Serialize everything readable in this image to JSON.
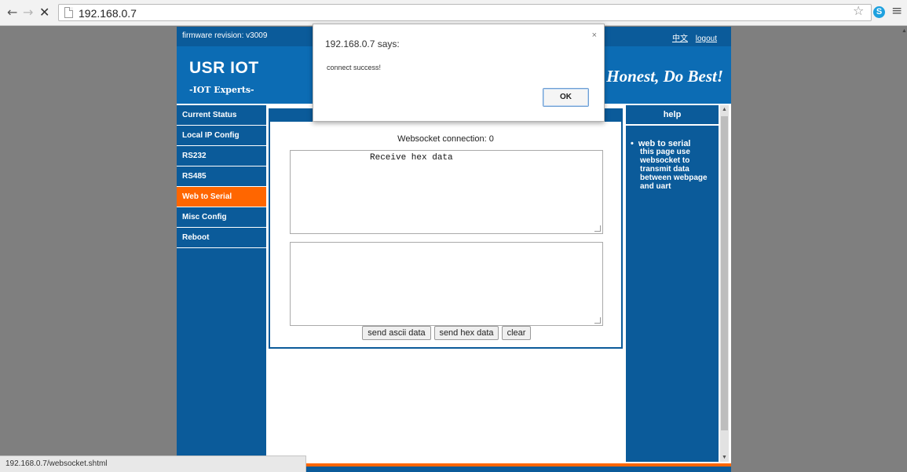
{
  "browser": {
    "url": "192.168.0.7",
    "icons": {
      "back": "arrow-left-icon",
      "forward": "arrow-right-icon",
      "stop": "close-icon",
      "bookmark": "star-icon",
      "extension": "skype-icon",
      "menu": "hamburger-menu-icon"
    },
    "back_glyph": "←",
    "forward_glyph": "→",
    "stop_glyph": "✕",
    "star_glyph": "☆",
    "skype_glyph": "S",
    "menu_glyph": "≡",
    "status_url": "192.168.0.7/websocket.shtml"
  },
  "page": {
    "firmware_label": "firmware revision: v3009",
    "language_link": "中文",
    "logout_link": "logout",
    "brand": "USR IOT",
    "brand_sub": "-IOT Experts-",
    "slogan": "Honest, Do Best!",
    "sidebar": {
      "items": [
        {
          "label": "Current Status",
          "active": false
        },
        {
          "label": "Local IP Config",
          "active": false
        },
        {
          "label": "RS232",
          "active": false
        },
        {
          "label": "RS485",
          "active": false
        },
        {
          "label": "Web to Serial",
          "active": true
        },
        {
          "label": "Misc Config",
          "active": false
        },
        {
          "label": "Reboot",
          "active": false
        }
      ]
    },
    "main": {
      "ws_status": "Websocket connection: 0",
      "receive_text": "Receive hex data",
      "send_text": "",
      "buttons": {
        "send_ascii": "send ascii data",
        "send_hex": "send hex data",
        "clear": "clear"
      }
    },
    "help": {
      "heading": "help",
      "title": "web to serial",
      "body": "this page use websocket to transmit data between webpage and uart"
    }
  },
  "dialog": {
    "title": "192.168.0.7 says:",
    "close_glyph": "×",
    "message": "connect success!",
    "ok_label": "OK"
  },
  "colors": {
    "nav_blue": "#0b5b9a",
    "banner_blue": "#0c6cb4",
    "active_orange": "#ff6600",
    "page_gray": "#7f7f7f"
  }
}
